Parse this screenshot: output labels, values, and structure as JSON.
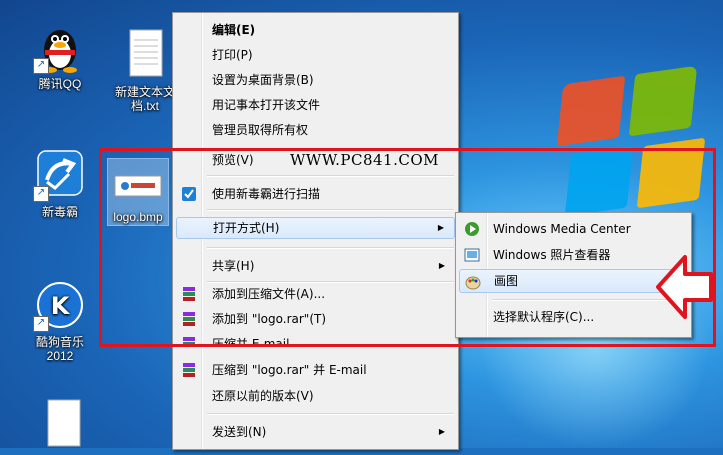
{
  "desktop_icons": [
    {
      "label": "腾讯QQ",
      "icon": "qq-penguin-icon"
    },
    {
      "label": "新建文本文\n档.txt",
      "icon": "text-file-icon"
    },
    {
      "label": "新毒霸",
      "icon": "duba-antivirus-icon"
    },
    {
      "label": "logo.bmp",
      "icon": "bmp-file-icon"
    },
    {
      "label": "酷狗音乐\n2012",
      "icon": "kugou-music-icon"
    }
  ],
  "context_menu": {
    "items": [
      {
        "label": "编辑(E)",
        "bold": true
      },
      {
        "label": "打印(P)"
      },
      {
        "label": "设置为桌面背景(B)"
      },
      {
        "label": "用记事本打开该文件"
      },
      {
        "label": "管理员取得所有权"
      },
      {
        "label": "预览(V)"
      },
      {
        "label": "使用新毒霸进行扫描",
        "icon": "duba-scan-icon"
      },
      {
        "label": "打开方式(H)",
        "submenu": true
      },
      {
        "label": "共享(H)",
        "submenu": true
      },
      {
        "label": "添加到压缩文件(A)...",
        "icon": "winrar-icon"
      },
      {
        "label": "添加到 \"logo.rar\"(T)",
        "icon": "winrar-icon"
      },
      {
        "label": "压缩并 E-mail",
        "icon": "winrar-icon"
      },
      {
        "label": "压缩到 \"logo.rar\" 并 E-mail",
        "icon": "winrar-icon"
      },
      {
        "label": "还原以前的版本(V)"
      },
      {
        "label": "发送到(N)",
        "submenu": true
      }
    ],
    "submenu_arrow": "▶"
  },
  "open_with_submenu": {
    "items": [
      {
        "label": "Windows Media Center",
        "icon": "media-center-icon"
      },
      {
        "label": "Windows 照片查看器",
        "icon": "photo-viewer-icon"
      },
      {
        "label": "画图",
        "icon": "paint-icon",
        "highlighted": true
      },
      {
        "label": "选择默认程序(C)..."
      }
    ]
  },
  "watermark": "WWW.PC841.COM",
  "colors": {
    "highlight_box": "#e0141e",
    "menu_bg": "#f0f0f0"
  }
}
